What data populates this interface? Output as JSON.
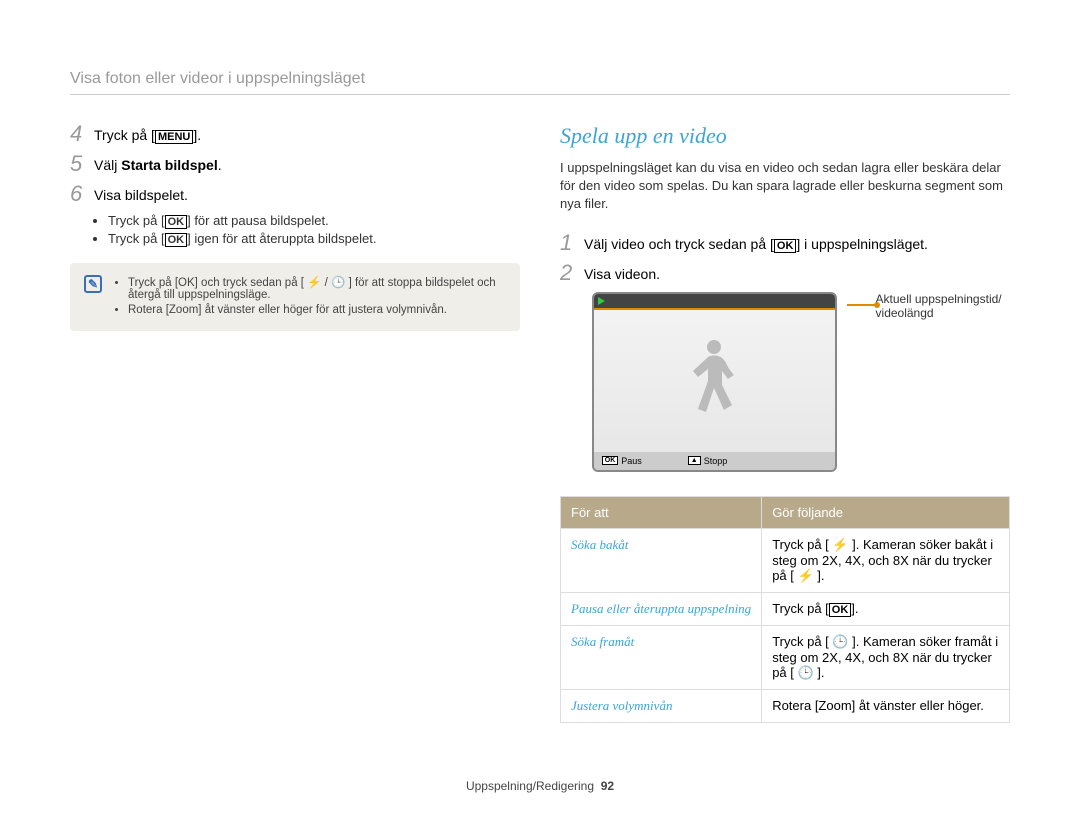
{
  "breadcrumb": "Visa foton eller videor i uppspelningsläget",
  "left": {
    "steps": [
      {
        "n": "4",
        "pre": "Tryck på [",
        "btn": "MENU",
        "post": "]."
      },
      {
        "n": "5",
        "pre": "Välj ",
        "bold": "Starta bildspel",
        "post": "."
      },
      {
        "n": "6",
        "text": "Visa bildspelet."
      }
    ],
    "sub": [
      {
        "pre": "Tryck på [",
        "btn": "OK",
        "post": "] för att pausa bildspelet."
      },
      {
        "pre": "Tryck på [",
        "btn": "OK",
        "post": "] igen för att återuppta bildspelet."
      }
    ],
    "note": [
      "Tryck på [OK] och tryck sedan på [ ⚡ / 🕒 ] för att stoppa bildspelet och återgå till uppspelningsläge.",
      "Rotera [Zoom] åt vänster eller höger för att justera volymnivån."
    ]
  },
  "right": {
    "heading": "Spela upp en video",
    "intro": "I uppspelningsläget kan du visa en video och sedan lagra eller beskära delar för den video som spelas. Du kan spara lagrade eller beskurna segment som nya filer.",
    "steps": [
      {
        "n": "1",
        "pre": "Välj video och tryck sedan på [",
        "btn": "OK",
        "post": "] i uppspelningsläget."
      },
      {
        "n": "2",
        "text": "Visa videon."
      }
    ],
    "callout": "Aktuell uppspelningstid/ videolängd",
    "player": {
      "pause_label": "Paus",
      "stop_label": "Stopp",
      "ok_btn": "OK",
      "up_btn": "▲"
    },
    "table": {
      "header": [
        "För att",
        "Gör följande"
      ],
      "rows": [
        {
          "a": "Söka bakåt",
          "b": "Tryck på [ ⚡ ]. Kameran söker bakåt i steg om 2X, 4X, och 8X när du trycker på [ ⚡ ]."
        },
        {
          "a": "Pausa eller återuppta uppspelning",
          "b_pre": "Tryck på [",
          "b_btn": "OK",
          "b_post": "]."
        },
        {
          "a": "Söka framåt",
          "b": "Tryck på [ 🕒 ]. Kameran söker framåt i steg om 2X, 4X, och 8X när du trycker på [ 🕒 ]."
        },
        {
          "a": "Justera volymnivån",
          "b": "Rotera [Zoom] åt vänster eller höger."
        }
      ]
    }
  },
  "footer": {
    "section": "Uppspelning/Redigering",
    "page": "92"
  }
}
